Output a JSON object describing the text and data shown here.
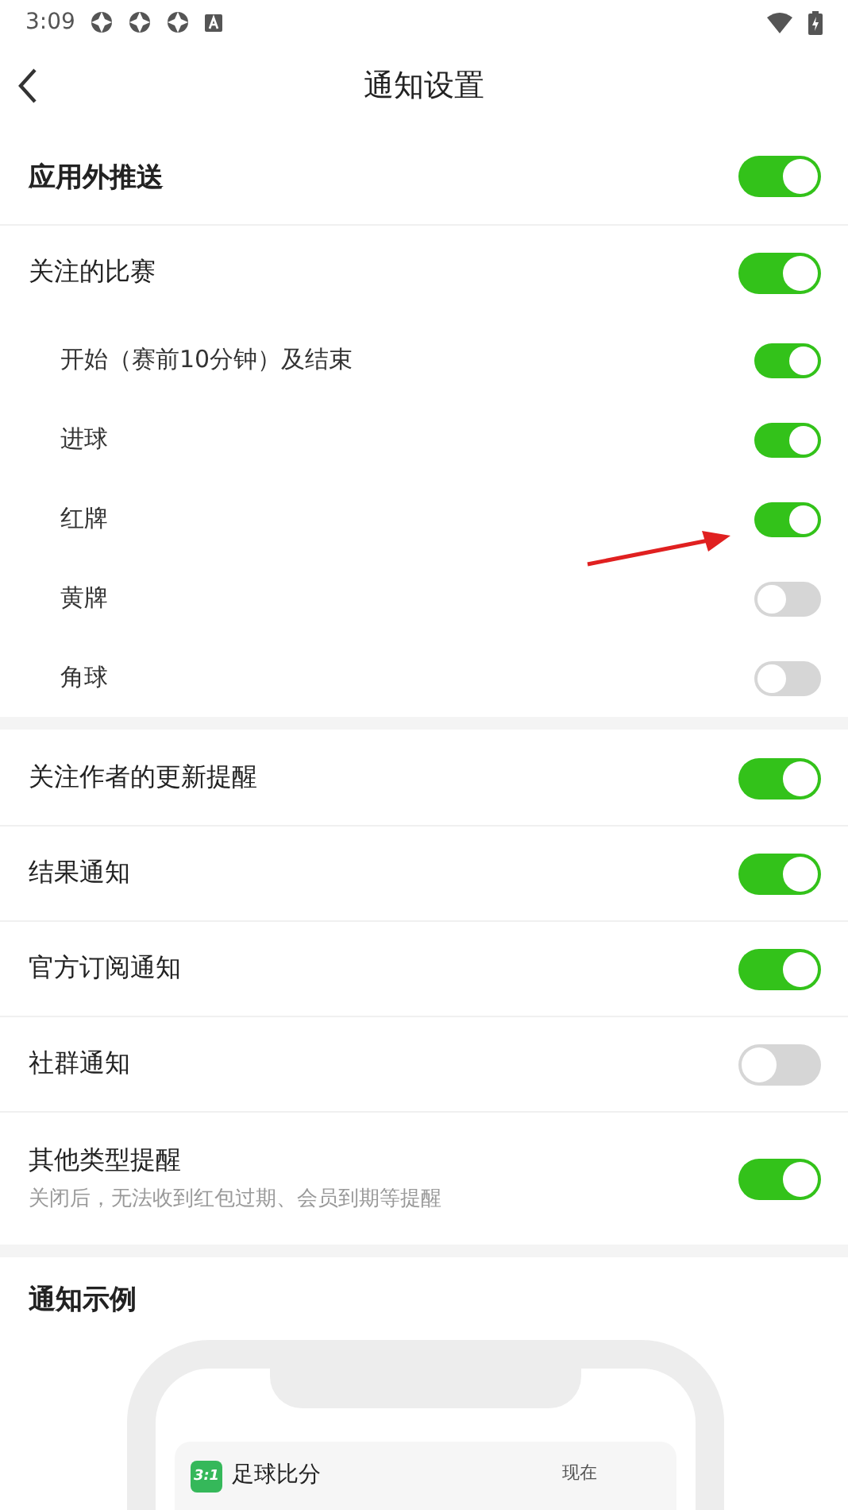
{
  "status_bar": {
    "time": "3:09"
  },
  "header": {
    "title": "通知设置"
  },
  "groups": [
    {
      "items": [
        {
          "kind": "master",
          "label": "应用外推送",
          "on": true
        },
        {
          "kind": "switch",
          "label": "关注的比赛",
          "on": true,
          "children": [
            {
              "kind": "switch",
              "label": "开始（赛前10分钟）及结束",
              "on": true
            },
            {
              "kind": "switch",
              "label": "进球",
              "on": true
            },
            {
              "kind": "switch",
              "label": "红牌",
              "on": true
            },
            {
              "kind": "switch",
              "label": "黄牌",
              "on": false
            },
            {
              "kind": "switch",
              "label": "角球",
              "on": false
            }
          ]
        }
      ]
    },
    {
      "items": [
        {
          "kind": "switch",
          "label": "关注作者的更新提醒",
          "on": true
        },
        {
          "kind": "switch",
          "label": "结果通知",
          "on": true
        },
        {
          "kind": "switch",
          "label": "官方订阅通知",
          "on": true
        },
        {
          "kind": "switch",
          "label": "社群通知",
          "on": false
        },
        {
          "kind": "switch",
          "label": "其他类型提醒",
          "description": "关闭后，无法收到红包过期、会员到期等提醒",
          "on": true
        }
      ]
    }
  ],
  "example": {
    "title": "通知示例",
    "notification": {
      "app_icon": "3:1",
      "app_name": "足球比分",
      "time": "现在"
    }
  }
}
